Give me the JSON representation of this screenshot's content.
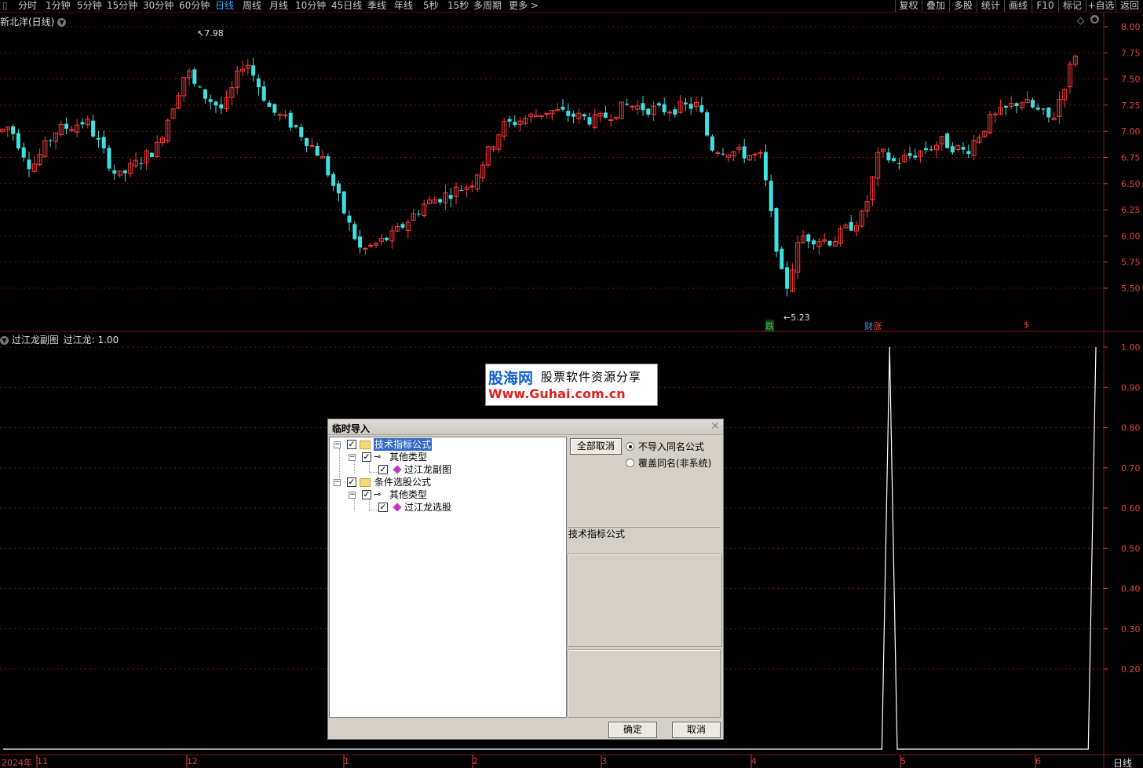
{
  "toolbar": {
    "periods": [
      "分时",
      "1分钟",
      "5分钟",
      "15分钟",
      "30分钟",
      "60分钟",
      "日线",
      "周线",
      "月线",
      "10分钟",
      "45日线",
      "季线",
      "年线",
      "5秒",
      "15秒",
      "多周期",
      "更多 >"
    ],
    "active_period": "日线",
    "right_buttons": [
      "复权",
      "叠加",
      "多股",
      "统计",
      "画线",
      "F10",
      "标记",
      "+自选",
      "返回"
    ]
  },
  "chart": {
    "stock_title": "新北洋(日线)",
    "y_axis_ticks": [
      "8.00",
      "7.75",
      "7.50",
      "7.25",
      "7.00",
      "6.75",
      "6.50",
      "6.25",
      "6.00",
      "5.75",
      "5.50"
    ],
    "high_annotation": "7.98",
    "low_annotation": "5.23",
    "signal_labels": [
      {
        "text": "跌",
        "color": "#2ecc40"
      },
      {
        "text": "财",
        "color": "#4aa0ff"
      },
      {
        "text": "涨",
        "color": "#ff4040"
      },
      {
        "text": "$",
        "color": "#ff4040"
      }
    ],
    "colors": {
      "up": "#ff3a3a",
      "down": "#40e0e0",
      "axis": "#e04040",
      "grid": "#7a1010"
    }
  },
  "sub_chart": {
    "title": "过江龙副图",
    "value_label": "过江龙: 1.00",
    "y_axis_ticks": [
      "1.00",
      "0.90",
      "0.80",
      "0.70",
      "0.60",
      "0.50",
      "0.40",
      "0.30",
      "0.20"
    ],
    "signal_values": [
      0,
      0,
      0,
      0,
      0,
      0,
      0,
      0,
      0,
      0,
      0,
      0,
      0,
      0,
      0,
      0,
      0,
      0,
      0,
      0,
      0,
      0,
      0,
      0,
      0,
      0,
      0,
      0,
      0,
      0,
      0,
      0,
      0,
      0,
      0,
      0,
      0,
      0,
      0,
      0,
      0,
      0,
      0,
      0,
      0,
      0,
      0,
      0,
      0,
      0,
      0,
      0,
      0,
      0,
      0,
      0,
      0,
      0,
      0,
      0,
      0,
      0,
      0,
      0,
      0,
      0,
      0,
      0,
      0,
      0,
      0,
      0,
      0,
      0,
      0,
      0,
      0,
      0,
      0,
      0,
      0,
      0,
      0,
      0,
      0,
      0,
      0,
      0,
      0,
      0,
      0,
      0,
      0,
      0,
      0,
      0,
      0,
      0,
      0,
      0,
      0,
      0,
      0,
      0,
      0,
      0,
      0,
      0,
      0,
      0,
      0,
      0,
      0,
      0,
      0,
      0,
      1,
      0,
      0,
      0,
      0,
      0,
      0,
      0,
      0,
      0,
      0,
      0,
      0,
      0,
      0,
      0,
      0,
      0,
      0,
      0,
      0,
      0,
      0,
      0,
      0,
      0,
      0,
      1
    ]
  },
  "date_axis": [
    "2024年",
    "11",
    "12",
    "1",
    "2",
    "3",
    "4",
    "5",
    "6"
  ],
  "period_label": "日线",
  "watermark": {
    "brand": "股海网",
    "slogan": "股票软件资源分享",
    "url": "Www.Guhai.com.cn"
  },
  "dialog": {
    "title": "临时导入",
    "tree": [
      {
        "label": "技术指标公式",
        "selected": true
      },
      {
        "label": "其他类型"
      },
      {
        "label": "过江龙副图"
      },
      {
        "label": "条件选股公式"
      },
      {
        "label": "其他类型"
      },
      {
        "label": "过江龙选股"
      }
    ],
    "cancel_all": "全部取消",
    "radio_options": [
      {
        "label": "不导入同名公式",
        "checked": true
      },
      {
        "label": "覆盖同名(非系统)",
        "checked": false
      }
    ],
    "info_label": "技术指标公式",
    "ok": "确定",
    "cancel": "取消"
  }
}
